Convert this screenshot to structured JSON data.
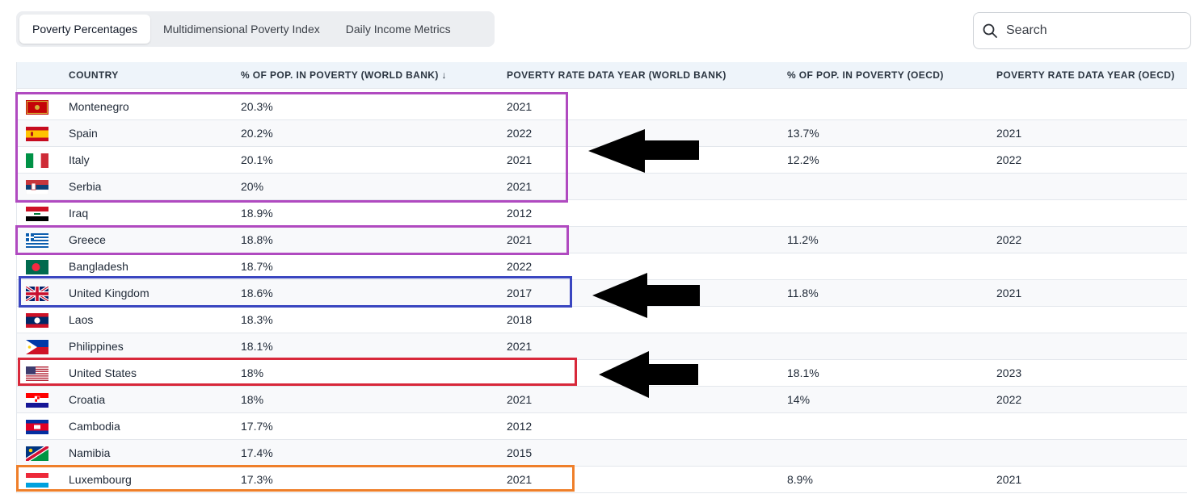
{
  "tabs": [
    {
      "label": "Poverty Percentages",
      "active": true
    },
    {
      "label": "Multidimensional Poverty Index",
      "active": false
    },
    {
      "label": "Daily Income Metrics",
      "active": false
    }
  ],
  "search": {
    "placeholder": "Search"
  },
  "table": {
    "columns": [
      "COUNTRY",
      "% OF POP. IN POVERTY (WORLD BANK) ↓",
      "POVERTY RATE DATA YEAR (WORLD BANK)",
      "% OF POP. IN POVERTY (OECD)",
      "POVERTY RATE DATA YEAR (OECD)"
    ],
    "rows": [
      {
        "country": "Montenegro",
        "flag": "montenegro-flag",
        "wb_pct": "20.3%",
        "wb_year": "2021",
        "oecd_pct": "",
        "oecd_year": ""
      },
      {
        "country": "Spain",
        "flag": "spain-flag",
        "wb_pct": "20.2%",
        "wb_year": "2022",
        "oecd_pct": "13.7%",
        "oecd_year": "2021"
      },
      {
        "country": "Italy",
        "flag": "italy-flag",
        "wb_pct": "20.1%",
        "wb_year": "2021",
        "oecd_pct": "12.2%",
        "oecd_year": "2022"
      },
      {
        "country": "Serbia",
        "flag": "serbia-flag",
        "wb_pct": "20%",
        "wb_year": "2021",
        "oecd_pct": "",
        "oecd_year": ""
      },
      {
        "country": "Iraq",
        "flag": "iraq-flag",
        "wb_pct": "18.9%",
        "wb_year": "2012",
        "oecd_pct": "",
        "oecd_year": ""
      },
      {
        "country": "Greece",
        "flag": "greece-flag",
        "wb_pct": "18.8%",
        "wb_year": "2021",
        "oecd_pct": "11.2%",
        "oecd_year": "2022"
      },
      {
        "country": "Bangladesh",
        "flag": "bangladesh-flag",
        "wb_pct": "18.7%",
        "wb_year": "2022",
        "oecd_pct": "",
        "oecd_year": ""
      },
      {
        "country": "United Kingdom",
        "flag": "united-kingdom-flag",
        "wb_pct": "18.6%",
        "wb_year": "2017",
        "oecd_pct": "11.8%",
        "oecd_year": "2021"
      },
      {
        "country": "Laos",
        "flag": "laos-flag",
        "wb_pct": "18.3%",
        "wb_year": "2018",
        "oecd_pct": "",
        "oecd_year": ""
      },
      {
        "country": "Philippines",
        "flag": "philippines-flag",
        "wb_pct": "18.1%",
        "wb_year": "2021",
        "oecd_pct": "",
        "oecd_year": ""
      },
      {
        "country": "United States",
        "flag": "united-states-flag",
        "wb_pct": "18%",
        "wb_year": "",
        "oecd_pct": "18.1%",
        "oecd_year": "2023"
      },
      {
        "country": "Croatia",
        "flag": "croatia-flag",
        "wb_pct": "18%",
        "wb_year": "2021",
        "oecd_pct": "14%",
        "oecd_year": "2022"
      },
      {
        "country": "Cambodia",
        "flag": "cambodia-flag",
        "wb_pct": "17.7%",
        "wb_year": "2012",
        "oecd_pct": "",
        "oecd_year": ""
      },
      {
        "country": "Namibia",
        "flag": "namibia-flag",
        "wb_pct": "17.4%",
        "wb_year": "2015",
        "oecd_pct": "",
        "oecd_year": ""
      },
      {
        "country": "Luxembourg",
        "flag": "luxembourg-flag",
        "wb_pct": "17.3%",
        "wb_year": "2021",
        "oecd_pct": "8.9%",
        "oecd_year": "2021"
      }
    ]
  },
  "annotations": {
    "colors": {
      "purple": "#b04ac0",
      "blue": "#3a46c0",
      "red": "#d8283a",
      "orange": "#ef7f2a",
      "arrow": "#000000"
    },
    "highlighted_countries": [
      "Montenegro",
      "Spain",
      "Italy",
      "Serbia",
      "Greece",
      "United Kingdom",
      "United States",
      "Luxembourg"
    ],
    "arrows": [
      "left-arrow",
      "left-arrow",
      "left-arrow"
    ]
  }
}
